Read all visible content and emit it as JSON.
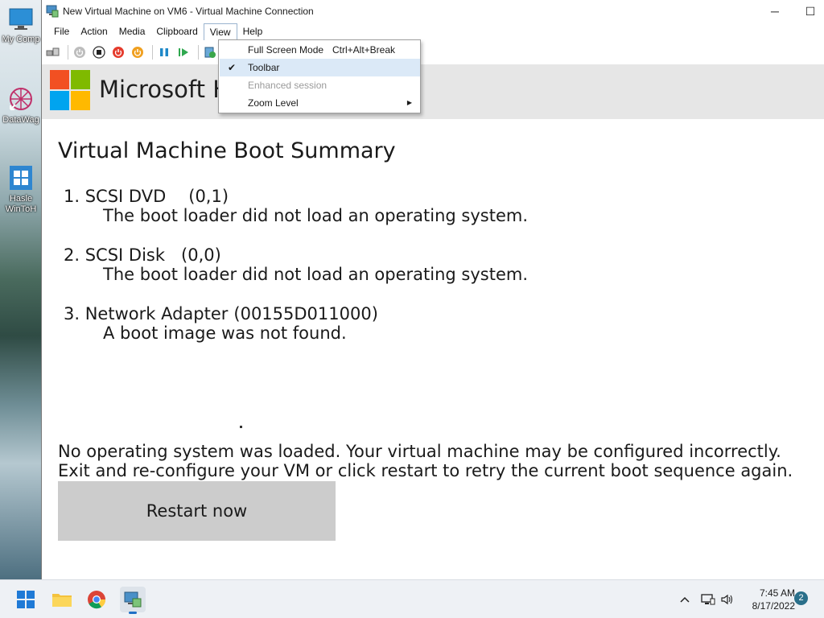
{
  "desktop": {
    "icons": [
      {
        "label": "My Comp"
      },
      {
        "label": "DataWag"
      },
      {
        "label": "Hasle"
      },
      {
        "label": "WinToH"
      }
    ]
  },
  "window": {
    "title": "New Virtual Machine on VM6 - Virtual Machine Connection",
    "minimize": "─",
    "maximize": "☐"
  },
  "menu": {
    "items": [
      "File",
      "Action",
      "Media",
      "Clipboard",
      "View",
      "Help"
    ],
    "open": "View"
  },
  "view_menu": {
    "items": [
      {
        "label": "Full Screen Mode",
        "shortcut": "Ctrl+Alt+Break",
        "checked": false,
        "enabled": true
      },
      {
        "label": "Toolbar",
        "shortcut": "",
        "checked": true,
        "enabled": true
      },
      {
        "label": "Enhanced session",
        "shortcut": "",
        "checked": false,
        "enabled": false
      },
      {
        "label": "Zoom Level",
        "shortcut": "",
        "checked": false,
        "enabled": true,
        "submenu": true
      }
    ],
    "check_glyph": "✔",
    "submenu_glyph": "▶"
  },
  "vm_screen": {
    "banner_text": "Microsoft H",
    "boot_title": "Virtual Machine Boot Summary",
    "boot_entries": [
      {
        "device": "1. SCSI DVD",
        "param": "(0,1)",
        "message": "The boot loader did not load an operating system."
      },
      {
        "device": "2. SCSI Disk",
        "param": "(0,0)",
        "message": "The boot loader did not load an operating system."
      },
      {
        "device": "3. Network Adapter",
        "param": "(00155D011000)",
        "message": "A boot image was not found."
      }
    ],
    "footer_line1": "No operating system was loaded. Your virtual machine may be configured incorrectly.",
    "footer_line2": "Exit and re-configure your VM or click restart to retry the current boot sequence again.",
    "restart_label": "Restart now"
  },
  "taskbar": {
    "time": "7:45 AM",
    "date": "8/17/2022",
    "notification_count": "2",
    "tray_chevron": "^"
  },
  "colors": {
    "ms_red": "#f25022",
    "ms_green": "#7fba00",
    "ms_blue": "#00a4ef",
    "ms_yellow": "#ffb900",
    "restart_bg": "#cccccc",
    "banner_bg": "#e6e6e6"
  }
}
